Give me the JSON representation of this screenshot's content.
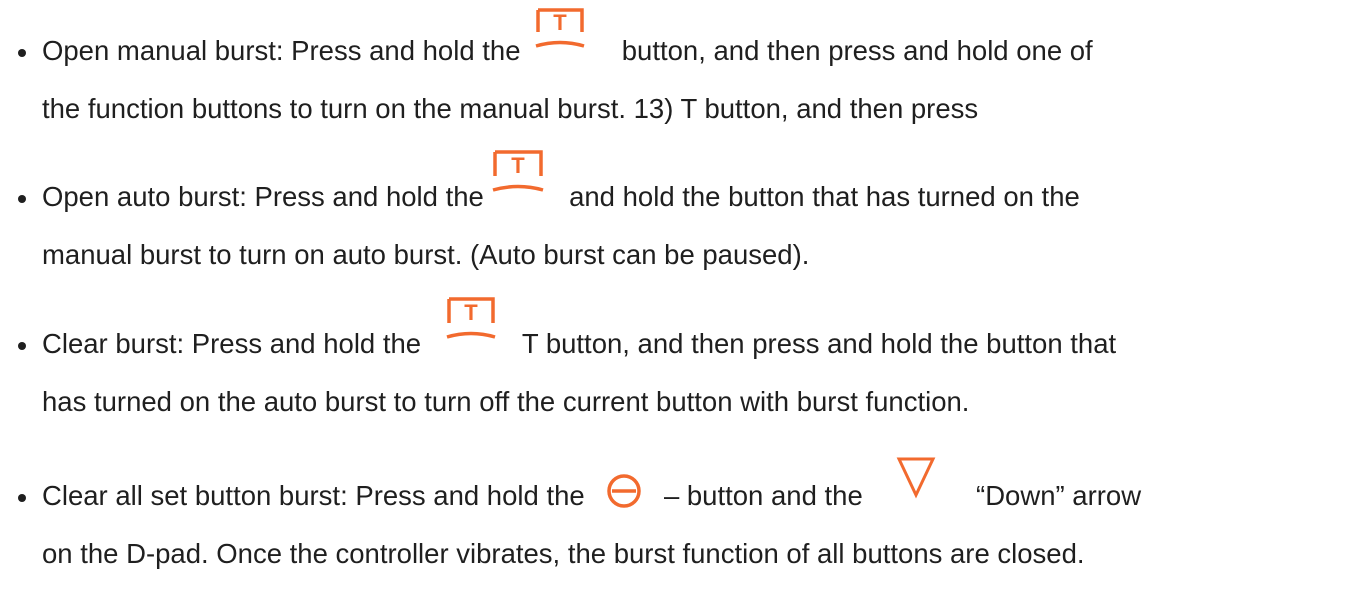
{
  "instructions": [
    {
      "lines": [
        [
          "Open manual burst: Press and hold the ",
          "t-icon",
          " button, and then press and hold one of"
        ],
        [
          "the function buttons to turn on the manual burst. 13) T button, and then press"
        ]
      ]
    },
    {
      "lines": [
        [
          "Open auto burst: Press and hold the ",
          "t-icon",
          " and hold the button that has turned on the"
        ],
        [
          "manual burst to turn on auto burst. (Auto burst can be paused)."
        ]
      ]
    },
    {
      "lines": [
        [
          "Clear burst: Press and hold the ",
          "t-icon",
          " T button, and then press and hold the button that"
        ],
        [
          "has turned on the auto burst to turn off the current button with burst function."
        ]
      ]
    },
    {
      "lines": [
        [
          "Clear all set button burst: Press and hold the ",
          "minus-icon",
          " – button and the ",
          "down-triangle-icon",
          " “Down” arrow"
        ],
        [
          "on the D-pad. Once the controller vibrates, the burst function of all buttons are closed."
        ]
      ]
    }
  ],
  "icon_letter": "T",
  "accent_color": "#f26a2e"
}
